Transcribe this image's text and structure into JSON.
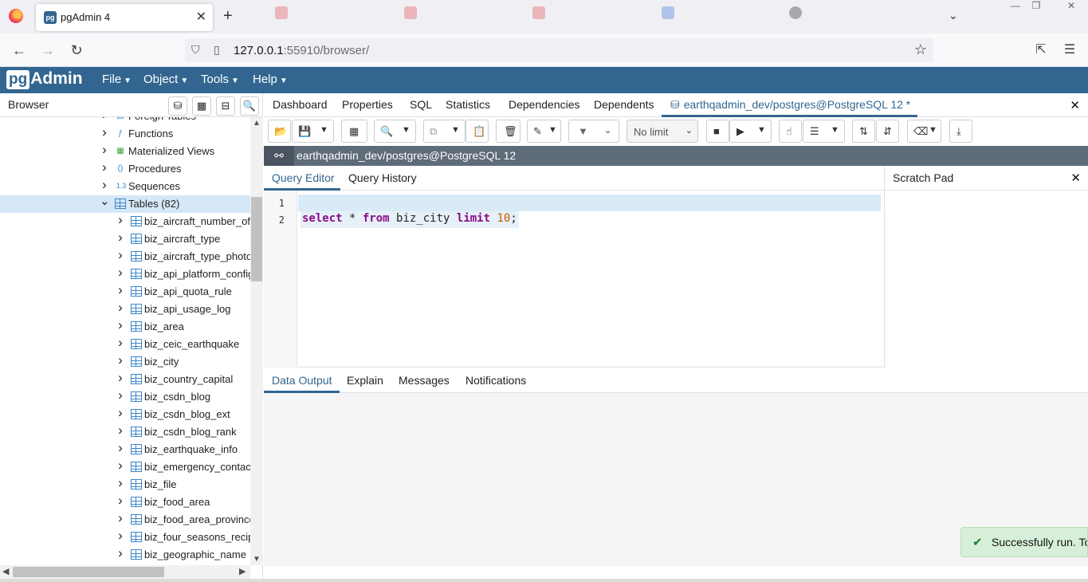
{
  "browser_chrome": {
    "tab_title": "pgAdmin 4",
    "favicon_text": "pg",
    "url_host": "127.0.0.1",
    "url_rest": ":55910/browser/"
  },
  "pgadmin": {
    "logo_pg": "pg",
    "logo_text": "Admin",
    "menus": [
      "File",
      "Object",
      "Tools",
      "Help"
    ]
  },
  "browser_panel": {
    "title": "Browser",
    "tree": [
      {
        "label": "Foreign Tables",
        "icon": "foreign-table-icon",
        "level": 0,
        "expanded": false
      },
      {
        "label": "Functions",
        "icon": "function-icon",
        "level": 0,
        "expanded": false
      },
      {
        "label": "Materialized Views",
        "icon": "matview-icon",
        "level": 0,
        "expanded": false
      },
      {
        "label": "Procedures",
        "icon": "procedure-icon",
        "level": 0,
        "expanded": false
      },
      {
        "label": "Sequences",
        "icon": "sequence-icon",
        "level": 0,
        "expanded": false
      },
      {
        "label": "Tables (82)",
        "icon": "tables-icon",
        "level": 0,
        "expanded": true,
        "selected": true
      },
      {
        "label": "biz_aircraft_number_of",
        "icon": "table-icon",
        "level": 1
      },
      {
        "label": "biz_aircraft_type",
        "icon": "table-icon",
        "level": 1
      },
      {
        "label": "biz_aircraft_type_photo",
        "icon": "table-icon",
        "level": 1
      },
      {
        "label": "biz_api_platform_config",
        "icon": "table-icon",
        "level": 1
      },
      {
        "label": "biz_api_quota_rule",
        "icon": "table-icon",
        "level": 1
      },
      {
        "label": "biz_api_usage_log",
        "icon": "table-icon",
        "level": 1
      },
      {
        "label": "biz_area",
        "icon": "table-icon",
        "level": 1
      },
      {
        "label": "biz_ceic_earthquake",
        "icon": "table-icon",
        "level": 1
      },
      {
        "label": "biz_city",
        "icon": "table-icon",
        "level": 1
      },
      {
        "label": "biz_country_capital",
        "icon": "table-icon",
        "level": 1
      },
      {
        "label": "biz_csdn_blog",
        "icon": "table-icon",
        "level": 1
      },
      {
        "label": "biz_csdn_blog_ext",
        "icon": "table-icon",
        "level": 1
      },
      {
        "label": "biz_csdn_blog_rank",
        "icon": "table-icon",
        "level": 1
      },
      {
        "label": "biz_earthquake_info",
        "icon": "table-icon",
        "level": 1
      },
      {
        "label": "biz_emergency_contact",
        "icon": "table-icon",
        "level": 1
      },
      {
        "label": "biz_file",
        "icon": "table-icon",
        "level": 1
      },
      {
        "label": "biz_food_area",
        "icon": "table-icon",
        "level": 1
      },
      {
        "label": "biz_food_area_province",
        "icon": "table-icon",
        "level": 1
      },
      {
        "label": "biz_four_seasons_recip",
        "icon": "table-icon",
        "level": 1
      },
      {
        "label": "biz_geographic_name",
        "icon": "table-icon",
        "level": 1
      }
    ]
  },
  "main_tabs": [
    "Dashboard",
    "Properties",
    "SQL",
    "Statistics",
    "Dependencies",
    "Dependents"
  ],
  "query_tab_label": "earthqadmin_dev/postgres@PostgreSQL 12 *",
  "toolbar": {
    "limit_value": "No limit"
  },
  "connection": "earthqadmin_dev/postgres@PostgreSQL 12",
  "editor_tabs": [
    "Query Editor",
    "Query History"
  ],
  "editor": {
    "line_numbers": [
      "1",
      "2"
    ],
    "line2": {
      "kw1": "select",
      "mid1": " * ",
      "kw2": "from",
      "mid2": " biz_city ",
      "kw3": "limit",
      "sp": " ",
      "num": "10",
      "end": ";"
    }
  },
  "scratch_pad": {
    "title": "Scratch Pad"
  },
  "result_tabs": [
    "Data Output",
    "Explain",
    "Messages",
    "Notifications"
  ],
  "toast": {
    "text": "Successfully run. Total query runtime"
  },
  "colors": {
    "brand": "#326690",
    "selected_row": "#d6e7f7",
    "conn_bar": "#5e6b78",
    "keyword": "#8a0a89",
    "number": "#c45c00",
    "success_bg": "#d7efd9"
  }
}
